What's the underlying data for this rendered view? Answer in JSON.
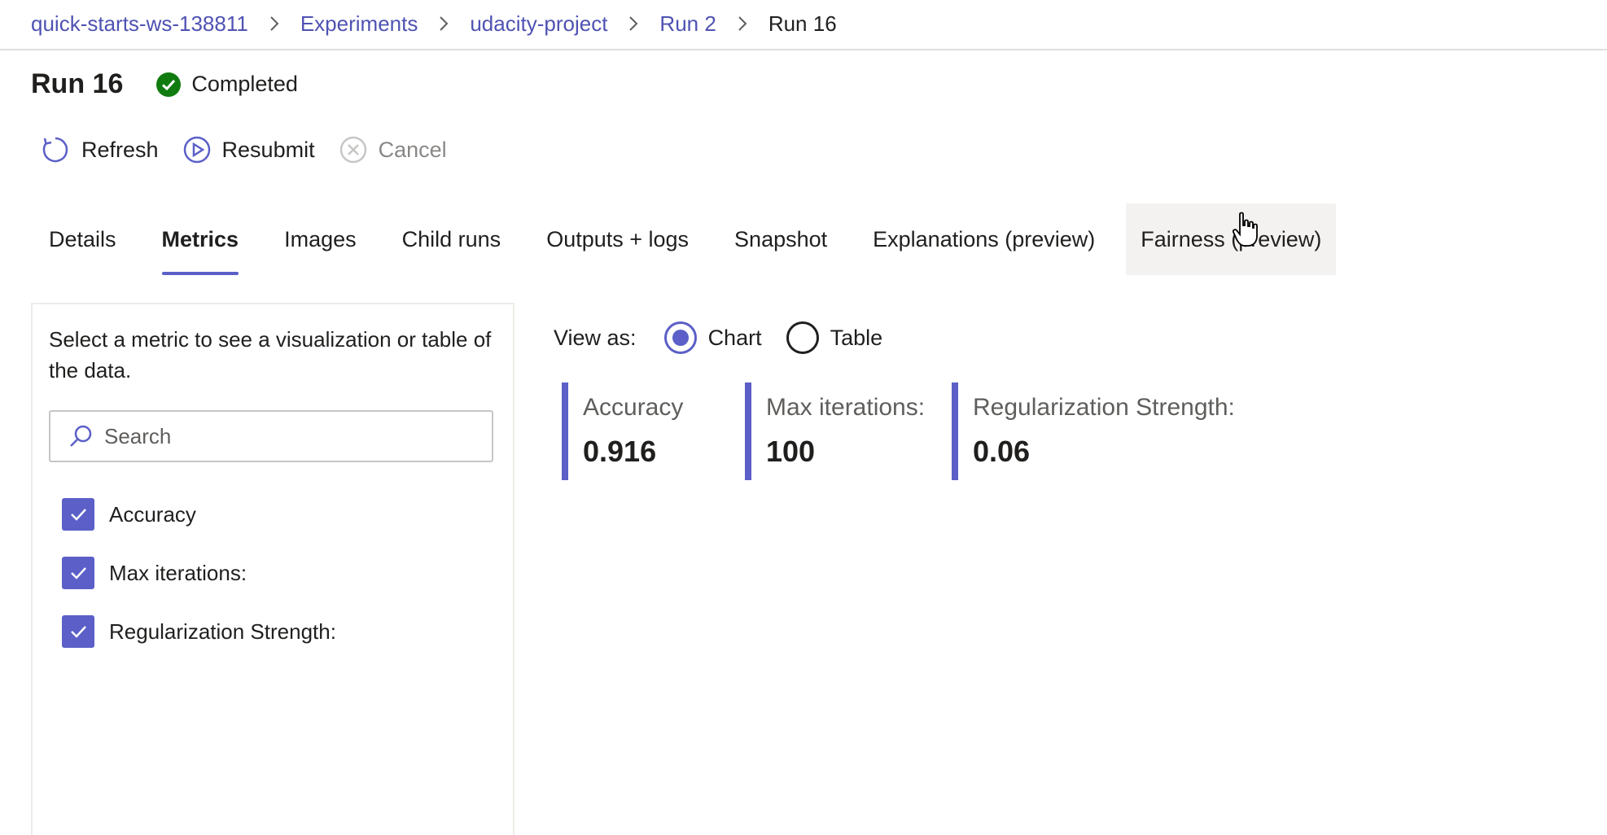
{
  "breadcrumb": {
    "items": [
      "quick-starts-ws-138811",
      "Experiments",
      "udacity-project",
      "Run 2"
    ],
    "current": "Run 16"
  },
  "run": {
    "title": "Run 16",
    "status": "Completed",
    "status_color": "#107c10"
  },
  "toolbar": {
    "refresh": "Refresh",
    "resubmit": "Resubmit",
    "cancel": "Cancel"
  },
  "tabs": [
    {
      "label": "Details"
    },
    {
      "label": "Metrics",
      "active": true
    },
    {
      "label": "Images"
    },
    {
      "label": "Child runs"
    },
    {
      "label": "Outputs + logs"
    },
    {
      "label": "Snapshot"
    },
    {
      "label": "Explanations (preview)"
    },
    {
      "label": "Fairness (preview)"
    }
  ],
  "metrics_panel": {
    "hint": "Select a metric to see a visualization or table of the data.",
    "search_placeholder": "Search",
    "items": [
      {
        "label": "Accuracy",
        "checked": true
      },
      {
        "label": "Max iterations:",
        "checked": true
      },
      {
        "label": "Regularization Strength:",
        "checked": true
      }
    ]
  },
  "view_as": {
    "label": "View as:",
    "options": [
      "Chart",
      "Table"
    ],
    "selected": "Chart"
  },
  "metric_cards": [
    {
      "label": "Accuracy",
      "value": "0.916"
    },
    {
      "label": "Max iterations:",
      "value": "100"
    },
    {
      "label": "Regularization Strength:",
      "value": "0.06"
    }
  ],
  "colors": {
    "accent": "#5b5fc7",
    "link": "#4f52b2"
  }
}
